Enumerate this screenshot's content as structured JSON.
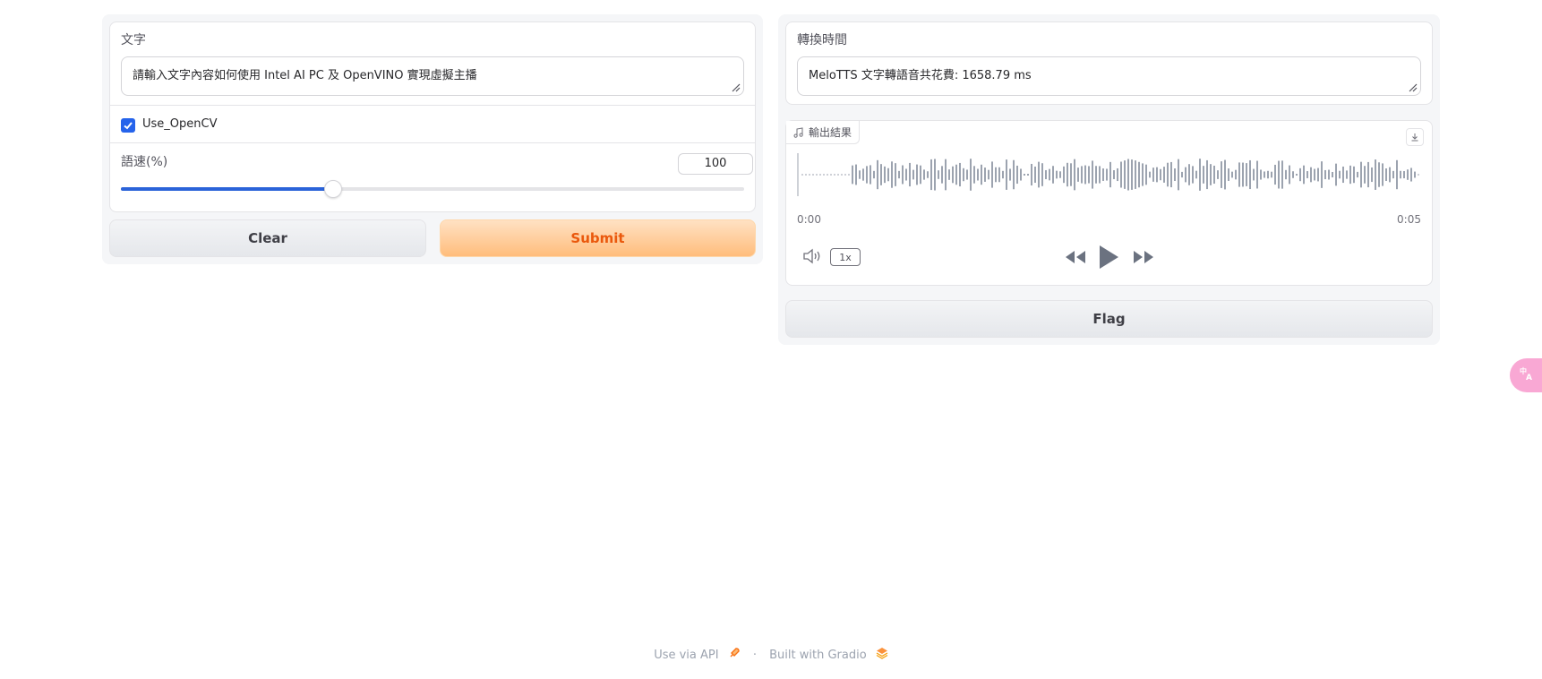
{
  "input_panel": {
    "text_label": "文字",
    "text_value": "請輸入文字內容如何使用 Intel AI PC 及 OpenVINO 實現虛擬主播",
    "checkbox_label": "Use_OpenCV",
    "checkbox_checked": true,
    "speed_label": "語速(%)",
    "speed_value": "100",
    "speed_slider_fraction": 0.34
  },
  "actions": {
    "clear_label": "Clear",
    "submit_label": "Submit"
  },
  "output_panel": {
    "time_label": "轉換時間",
    "time_value": "MeloTTS 文字轉語音共花費: 1658.79 ms",
    "audio_label": "輸出結果",
    "audio_start_time": "0:00",
    "audio_end_time": "0:05",
    "playback_rate": "1x",
    "flag_label": "Flag"
  },
  "footer": {
    "api_link": "Use via API",
    "separator": "·",
    "built_with": "Built with Gradio"
  },
  "colors": {
    "accent_blue": "#2563eb",
    "submit_orange": "#ea580c",
    "waveform_gray": "#9ca3af"
  },
  "icons": [
    "music-note-icon",
    "download-icon",
    "volume-icon",
    "rewind-icon",
    "play-icon",
    "fast-forward-icon",
    "rocket-icon",
    "gradio-logo-icon",
    "translate-icon"
  ]
}
